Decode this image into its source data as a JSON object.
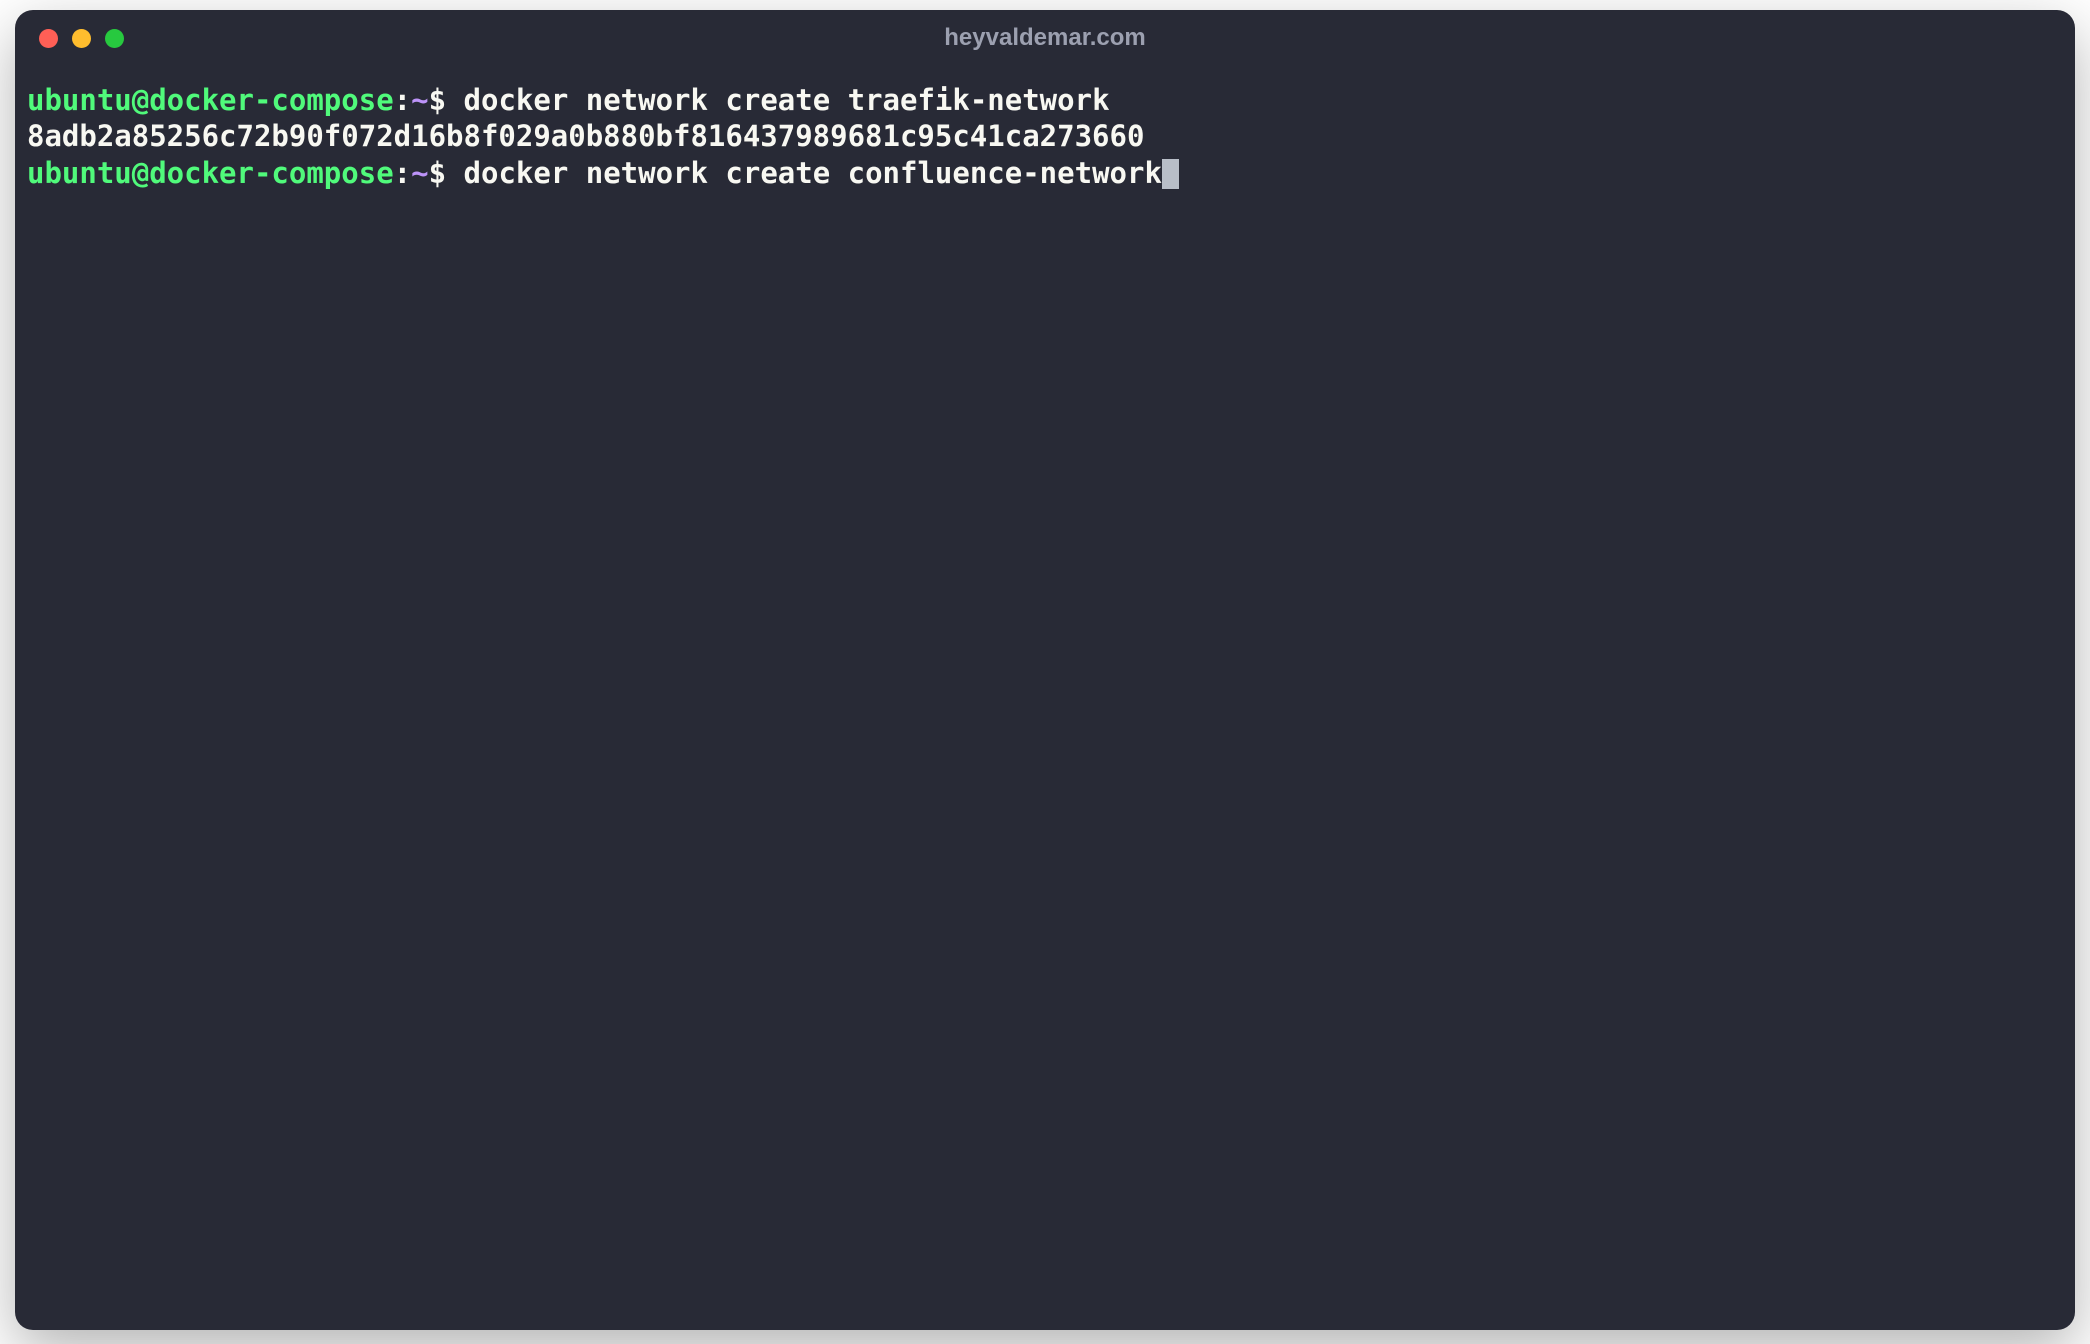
{
  "window": {
    "title": "heyvaldemar.com"
  },
  "prompt": {
    "user_host": "ubuntu@docker-compose",
    "colon": ":",
    "path": "~",
    "symbol": "$"
  },
  "lines": {
    "line1_command": " docker network create traefik-network",
    "line2_output": "8adb2a85256c72b90f072d16b8f029a0b880bf816437989681c95c41ca273660",
    "line3_command": " docker network create confluence-network"
  }
}
